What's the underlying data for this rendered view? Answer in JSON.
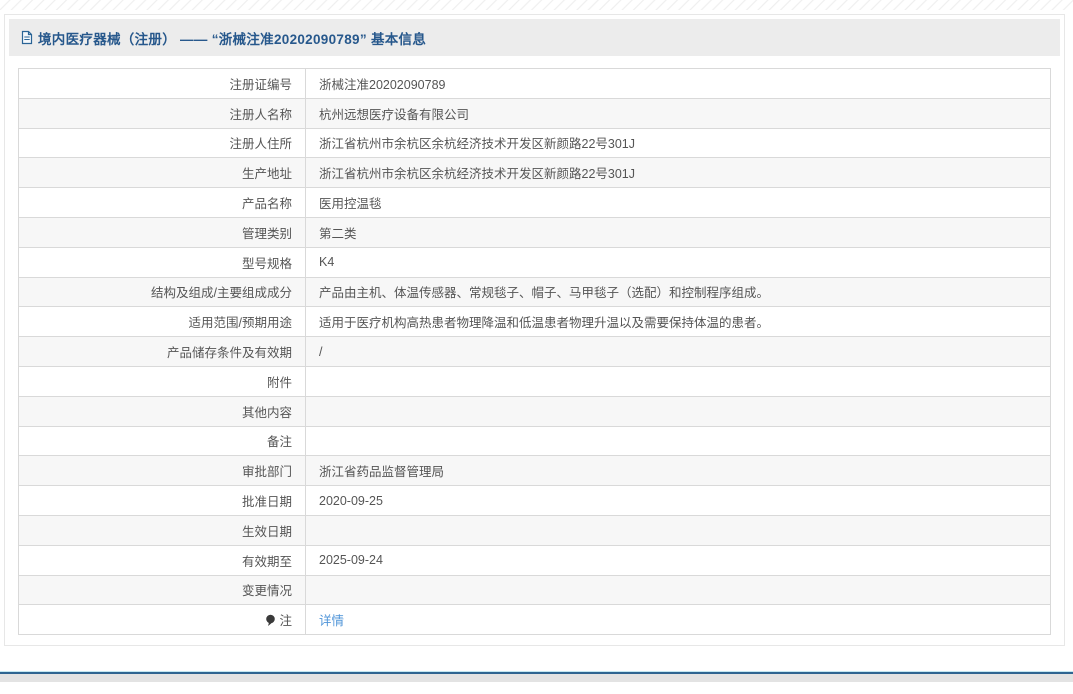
{
  "header": {
    "title": "境内医疗器械（注册） ——  “浙械注准20202090789”  基本信息"
  },
  "table": {
    "rows": [
      {
        "label": "注册证编号",
        "value": "浙械注准20202090789"
      },
      {
        "label": "注册人名称",
        "value": "杭州远想医疗设备有限公司"
      },
      {
        "label": "注册人住所",
        "value": "浙江省杭州市余杭区余杭经济技术开发区新颜路22号301J"
      },
      {
        "label": "生产地址",
        "value": "浙江省杭州市余杭区余杭经济技术开发区新颜路22号301J"
      },
      {
        "label": "产品名称",
        "value": "医用控温毯"
      },
      {
        "label": "管理类别",
        "value": "第二类"
      },
      {
        "label": "型号规格",
        "value": "K4"
      },
      {
        "label": "结构及组成/主要组成成分",
        "value": "产品由主机、体温传感器、常规毯子、帽子、马甲毯子（选配）和控制程序组成。"
      },
      {
        "label": "适用范围/预期用途",
        "value": "适用于医疗机构高热患者物理降温和低温患者物理升温以及需要保持体温的患者。"
      },
      {
        "label": "产品储存条件及有效期",
        "value": "/"
      },
      {
        "label": "附件",
        "value": ""
      },
      {
        "label": "其他内容",
        "value": ""
      },
      {
        "label": "备注",
        "value": ""
      },
      {
        "label": "审批部门",
        "value": "浙江省药品监督管理局"
      },
      {
        "label": "批准日期",
        "value": "2020-09-25"
      },
      {
        "label": "生效日期",
        "value": ""
      },
      {
        "label": "有效期至",
        "value": "2025-09-24"
      },
      {
        "label": "变更情况",
        "value": ""
      },
      {
        "label": "注",
        "value": "详情",
        "link": true,
        "icon": "note-icon"
      }
    ]
  },
  "colors": {
    "title_blue": "#27588c",
    "link_blue": "#4f94d8",
    "header_bar_bg": "#ececec",
    "alt_row_bg": "#f7f7f7",
    "border": "#d9d9d9",
    "footer_dark_blue": "#2f6591"
  }
}
